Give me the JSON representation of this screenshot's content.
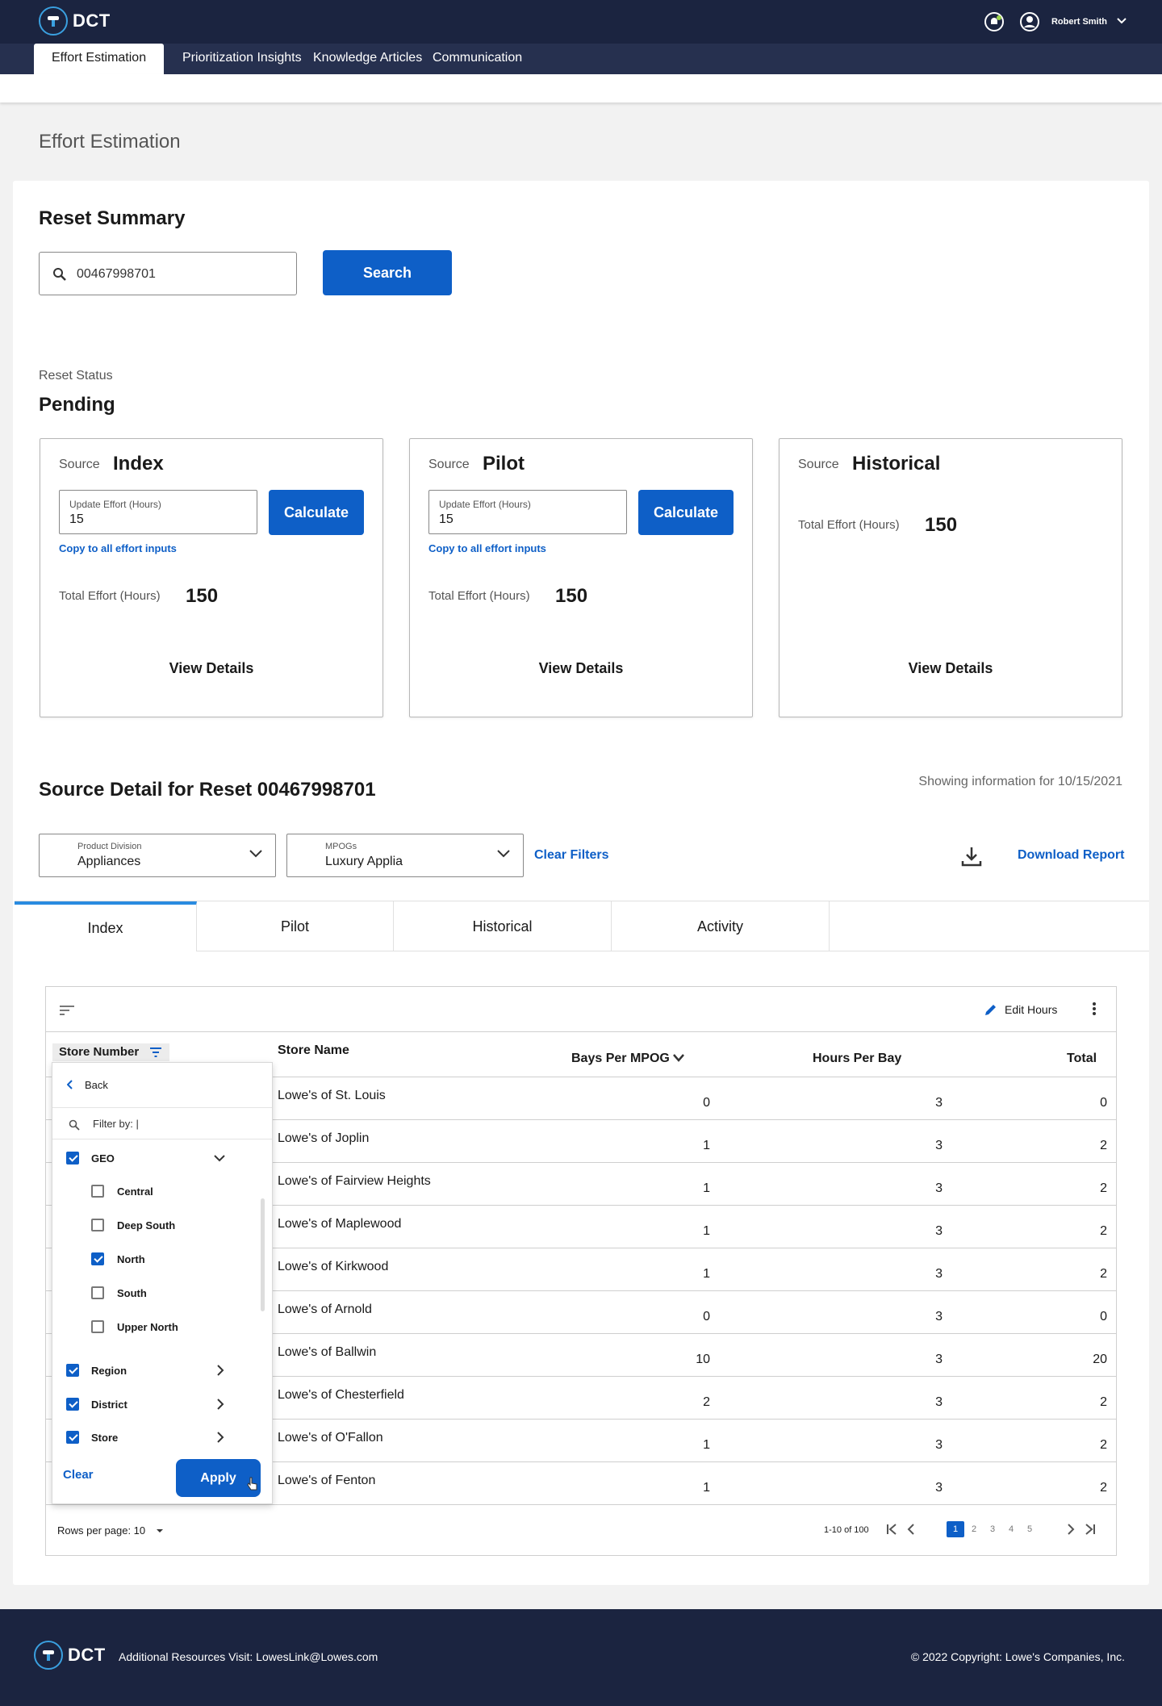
{
  "app": {
    "name": "DCT"
  },
  "user": {
    "name": "Robert Smith"
  },
  "nav": {
    "tabs": [
      "Effort Estimation",
      "Prioritization Insights",
      "Knowledge Articles",
      "Communication"
    ]
  },
  "page": {
    "title": "Effort Estimation"
  },
  "reset_summary": {
    "heading": "Reset Summary",
    "search_value": "00467998701",
    "search_button": "Search",
    "status_label": "Reset Status",
    "status_value": "Pending"
  },
  "sources": [
    {
      "label": "Source",
      "name": "Index",
      "input_label": "Update Effort (Hours)",
      "input_value": "15",
      "button": "Calculate",
      "copy_link": "Copy to all effort inputs",
      "total_label": "Total Effort (Hours)",
      "total_value": "150",
      "details": "View Details"
    },
    {
      "label": "Source",
      "name": "Pilot",
      "input_label": "Update Effort (Hours)",
      "input_value": "15",
      "button": "Calculate",
      "copy_link": "Copy to all effort inputs",
      "total_label": "Total Effort (Hours)",
      "total_value": "150",
      "details": "View Details"
    },
    {
      "label": "Source",
      "name": "Historical",
      "total_label": "Total Effort (Hours)",
      "total_value": "150",
      "details": "View Details"
    }
  ],
  "source_detail": {
    "title": "Source Detail for Reset 00467998701",
    "showing_info": "Showing information for 10/15/2021",
    "product_division": {
      "label": "Product Division",
      "value": "Appliances"
    },
    "mpogs": {
      "label": "MPOGs",
      "value": "Luxury Applia"
    },
    "clear_filters": "Clear Filters",
    "download_report": "Download Report",
    "tabs": [
      "Index",
      "Pilot",
      "Historical",
      "Activity"
    ]
  },
  "table": {
    "edit_hours": "Edit Hours",
    "columns": [
      "Store Number",
      "Store Name",
      "Bays Per MPOG",
      "Hours Per Bay",
      "Total"
    ],
    "rows": [
      {
        "name": "Lowe's of St. Louis",
        "bays": "0",
        "hours": "3",
        "total": "0"
      },
      {
        "name": "Lowe's of Joplin",
        "bays": "1",
        "hours": "3",
        "total": "2"
      },
      {
        "name": "Lowe's of Fairview Heights",
        "bays": "1",
        "hours": "3",
        "total": "2"
      },
      {
        "name": "Lowe's of Maplewood",
        "bays": "1",
        "hours": "3",
        "total": "2"
      },
      {
        "name": "Lowe's of Kirkwood",
        "bays": "1",
        "hours": "3",
        "total": "2"
      },
      {
        "name": "Lowe's of Arnold",
        "bays": "0",
        "hours": "3",
        "total": "0"
      },
      {
        "name": "Lowe's of Ballwin",
        "bays": "10",
        "hours": "3",
        "total": "20"
      },
      {
        "name": "Lowe's of Chesterfield",
        "bays": "2",
        "hours": "3",
        "total": "2"
      },
      {
        "name": "Lowe's of O'Fallon",
        "bays": "1",
        "hours": "3",
        "total": "2"
      },
      {
        "name": "Lowe's of Fenton",
        "bays": "1",
        "hours": "3",
        "total": "2"
      }
    ],
    "rows_per_page_label": "Rows per page: 10",
    "range": "1-10 of 100",
    "pages": [
      "1",
      "2",
      "3",
      "4",
      "5"
    ],
    "current_page": "1"
  },
  "filter_panel": {
    "back": "Back",
    "filter_placeholder": "Filter by: |",
    "groups": [
      {
        "label": "GEO",
        "checked": true,
        "expanded": true,
        "options": [
          {
            "label": "Central",
            "checked": false
          },
          {
            "label": "Deep South",
            "checked": false
          },
          {
            "label": "North",
            "checked": true
          },
          {
            "label": "South",
            "checked": false
          },
          {
            "label": "Upper North",
            "checked": false
          }
        ]
      },
      {
        "label": "Region",
        "checked": true
      },
      {
        "label": "District",
        "checked": true
      },
      {
        "label": "Store",
        "checked": true
      }
    ],
    "clear": "Clear",
    "apply": "Apply"
  },
  "footer": {
    "resources": "Additional Resources Visit: LowesLink@Lowes.com",
    "copyright": "© 2022 Copyright: Lowe's Companies, Inc."
  },
  "colors": {
    "primary": "#0e5fc7",
    "header": "#1b2440",
    "nav": "#26304f",
    "tab_accent": "#2a8be0"
  }
}
